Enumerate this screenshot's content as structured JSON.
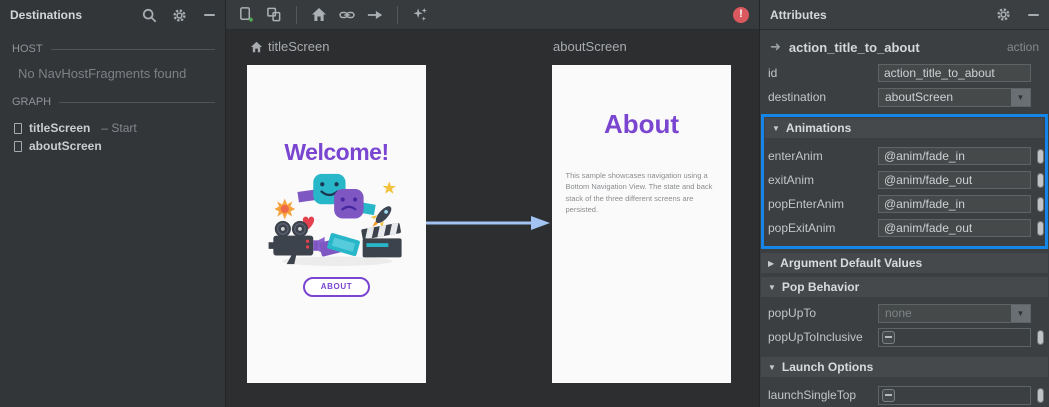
{
  "colors": {
    "accent_purple": "#7a45d0",
    "highlight_blue": "#1386e8",
    "error_red": "#d9595f",
    "arrow_blue": "#a3c4f3",
    "panel_bg": "#3c3f41",
    "canvas_bg": "#2c2e30"
  },
  "left_panel": {
    "title": "Destinations",
    "icons": [
      "search-icon",
      "gear-icon",
      "minimize-icon"
    ],
    "host": {
      "label": "HOST",
      "empty_message": "No NavHostFragments found"
    },
    "graph": {
      "label": "GRAPH",
      "items": [
        {
          "label": "titleScreen",
          "suffix": "– Start"
        },
        {
          "label": "aboutScreen",
          "suffix": ""
        }
      ]
    }
  },
  "canvas_toolbar": {
    "icons": [
      "new-destination-icon",
      "nested-graph-icon",
      "assign-start-home-icon",
      "deep-link-icon",
      "action-arrow-icon",
      "auto-arrange-icon"
    ],
    "error_badge": "!"
  },
  "canvas": {
    "screens": [
      {
        "name": "titleScreen",
        "is_start": true,
        "heading": "Welcome!",
        "button_label": "ABOUT"
      },
      {
        "name": "aboutScreen",
        "heading": "About",
        "body": "This sample showcases navigation using a Bottom Navigation View. The state and back stack of the three different screens are persisted."
      }
    ]
  },
  "attributes": {
    "title": "Attributes",
    "icons": [
      "gear-icon",
      "minimize-icon"
    ],
    "action_header": {
      "name": "action_title_to_about",
      "type": "action"
    },
    "id_row": {
      "label": "id",
      "value": "action_title_to_about"
    },
    "destination_row": {
      "label": "destination",
      "value": "aboutScreen"
    },
    "animations": {
      "header": "Animations",
      "rows": [
        {
          "label": "enterAnim",
          "value": "@anim/fade_in"
        },
        {
          "label": "exitAnim",
          "value": "@anim/fade_out"
        },
        {
          "label": "popEnterAnim",
          "value": "@anim/fade_in"
        },
        {
          "label": "popExitAnim",
          "value": "@anim/fade_out"
        }
      ]
    },
    "argument_defaults": {
      "header": "Argument Default Values"
    },
    "pop_behavior": {
      "header": "Pop Behavior",
      "popupto": {
        "label": "popUpTo",
        "value": "none"
      },
      "inclusive": {
        "label": "popUpToInclusive"
      }
    },
    "launch_options": {
      "header": "Launch Options",
      "single_top": {
        "label": "launchSingleTop"
      }
    }
  }
}
